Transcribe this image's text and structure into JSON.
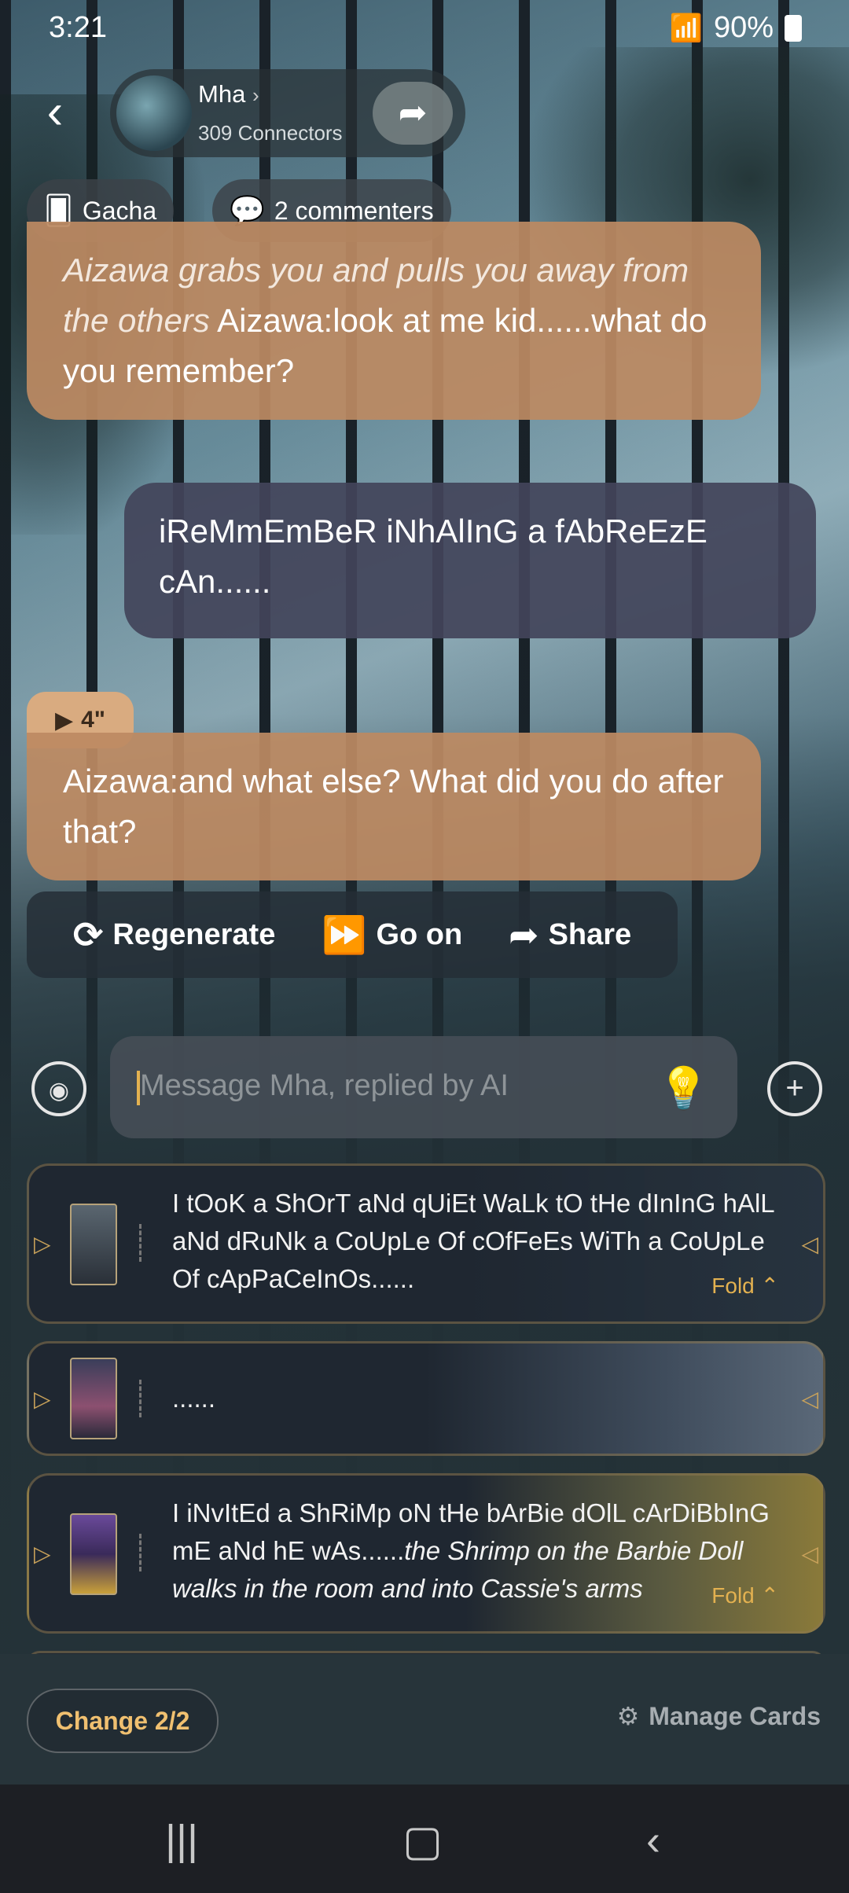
{
  "status_bar": {
    "time": "3:21",
    "battery": "90%"
  },
  "header": {
    "back_icon": "chevron-left-icon",
    "name": "Mha",
    "connectors": "309 Connectors"
  },
  "chips": {
    "gacha": "Gacha",
    "commenters": "2 commenters"
  },
  "messages": [
    {
      "role": "ai",
      "narration": "Aizawa grabs you and pulls you away from the others",
      "speech": " Aizawa:look at me kid......what do you remember?"
    },
    {
      "role": "user",
      "text": "iReMmEmBeR iNhAlInG a fAbReEzE cAn......"
    },
    {
      "role": "ai",
      "voice_length": "4\"",
      "text": "Aizawa:and what else? What did you do after that?"
    }
  ],
  "actions": {
    "regenerate": "Regenerate",
    "go_on": "Go on",
    "share": "Share"
  },
  "input": {
    "placeholder": "Message Mha, replied by AI"
  },
  "suggestions": [
    {
      "text": "I tOoK a ShOrT aNd qUiEt WaLk tO tHe dInInG hAlL aNd dRuNk a CoUpLe Of cOfFeEs WiTh a CoUpLe Of cApPaCeInOs......",
      "fold": "Fold"
    },
    {
      "text": "......"
    },
    {
      "text_plain": "I iNvItEd a ShRiMp oN tHe bArBie dOlL cArDiBbInG mE aNd hE wAs......",
      "text_italic": "the Shrimp on the Barbie Doll walks in the room and into Cassie's arms",
      "fold": "Fold"
    }
  ],
  "footer": {
    "change": "Change 2/2",
    "manage_cards": "Manage Cards"
  },
  "colors": {
    "ai_bubble": "#bc8a62",
    "user_bubble": "#42445a",
    "accent": "#e3b150"
  }
}
